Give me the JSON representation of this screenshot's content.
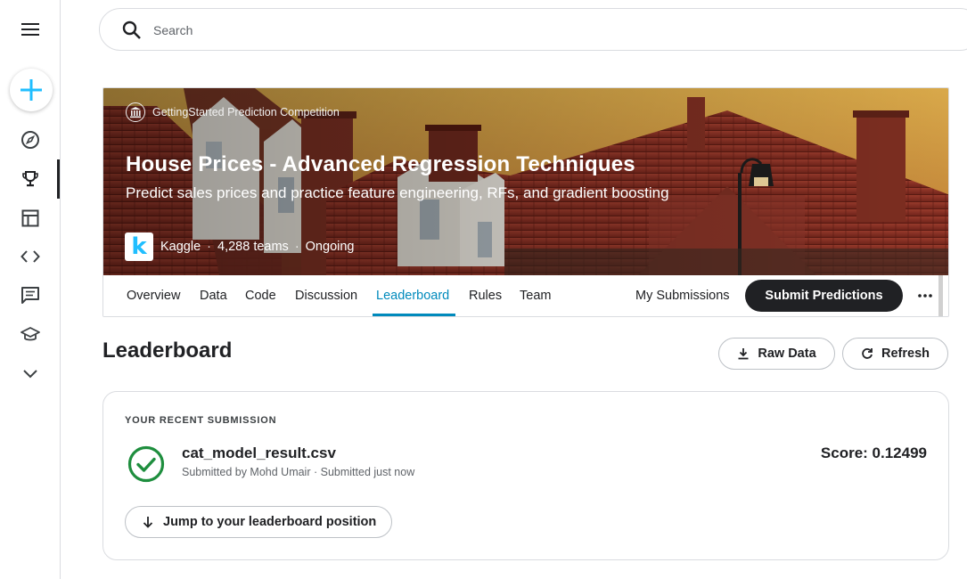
{
  "sidebar": {
    "items": [
      {
        "icon": "menu-icon"
      },
      {
        "icon": "plus-icon"
      },
      {
        "icon": "compass-icon"
      },
      {
        "icon": "trophy-icon",
        "active": true
      },
      {
        "icon": "table-icon"
      },
      {
        "icon": "code-icon"
      },
      {
        "icon": "comment-icon"
      },
      {
        "icon": "school-icon"
      },
      {
        "icon": "chevron-down-icon"
      }
    ]
  },
  "search": {
    "placeholder": "Search"
  },
  "competition": {
    "type_label": "GettingStarted Prediction Competition",
    "title": "House Prices - Advanced Regression Techniques",
    "subtitle": "Predict sales prices and practice feature engineering, RFs, and gradient boosting",
    "host_logo_letter": "k",
    "host": "Kaggle",
    "teams": "4,288 teams",
    "status": "Ongoing",
    "separator": "·"
  },
  "tabs": [
    {
      "label": "Overview"
    },
    {
      "label": "Data"
    },
    {
      "label": "Code"
    },
    {
      "label": "Discussion"
    },
    {
      "label": "Leaderboard",
      "active": true
    },
    {
      "label": "Rules"
    },
    {
      "label": "Team"
    }
  ],
  "actions": {
    "my_submissions": "My Submissions",
    "submit": "Submit Predictions",
    "more": "···"
  },
  "leaderboard": {
    "title": "Leaderboard",
    "raw_data": "Raw Data",
    "refresh": "Refresh"
  },
  "submission": {
    "section_label": "YOUR RECENT SUBMISSION",
    "file": "cat_model_result.csv",
    "meta": "Submitted by Mohd Umair · Submitted just now",
    "score": "Score: 0.12499",
    "jump": "Jump to your leaderboard position"
  },
  "colors": {
    "accent": "#008abc",
    "kaggle_blue": "#20beff",
    "success": "#1e8e3e",
    "dark": "#202124"
  }
}
